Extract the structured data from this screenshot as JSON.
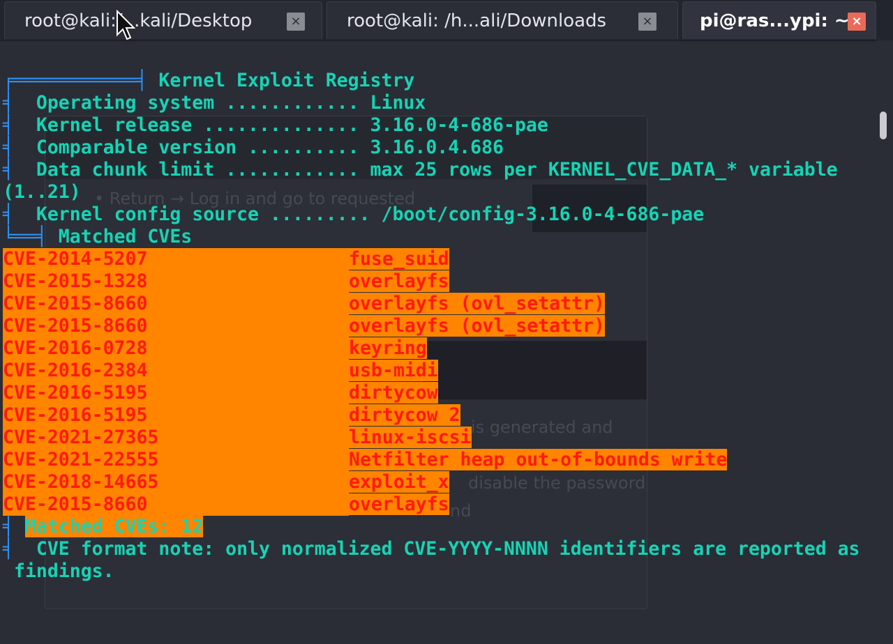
{
  "tabs": [
    {
      "title": "root@kali:/...kali/Desktop",
      "close_icon": "×"
    },
    {
      "title": "root@kali: /h...ali/Downloads",
      "close_icon": "×"
    },
    {
      "title": "pi@ras...ypi: ~",
      "close_icon": "×"
    }
  ],
  "terminal": {
    "header_title": "Kernel Exploit Registry",
    "info": [
      {
        "label": "Operating system ............",
        "value": "Linux"
      },
      {
        "label": "Kernel release ..............",
        "value": "3.16.0-4-686-pae"
      },
      {
        "label": "Comparable version ..........",
        "value": "3.16.0.4.686"
      },
      {
        "label": "Data chunk limit ............",
        "value": "max 25 rows per KERNEL_CVE_DATA_* variable"
      },
      {
        "label": "Kernel config source .........",
        "value": "/boot/config-3.16.0-4-686-pae"
      }
    ],
    "chunk_note": "(1..21)",
    "section_title": "Matched CVEs",
    "cves": [
      {
        "id": "CVE-2014-5207",
        "name": "fuse_suid"
      },
      {
        "id": "CVE-2015-1328",
        "name": "overlayfs"
      },
      {
        "id": "CVE-2015-8660",
        "name": "overlayfs (ovl_setattr)"
      },
      {
        "id": "CVE-2015-8660",
        "name": "overlayfs (ovl_setattr)"
      },
      {
        "id": "CVE-2016-0728",
        "name": "keyring"
      },
      {
        "id": "CVE-2016-2384",
        "name": "usb-midi"
      },
      {
        "id": "CVE-2016-5195",
        "name": "dirtycow"
      },
      {
        "id": "CVE-2016-5195",
        "name": "dirtycow 2"
      },
      {
        "id": "CVE-2021-27365",
        "name": "linux-iscsi"
      },
      {
        "id": "CVE-2021-22555",
        "name": "Netfilter heap out-of-bounds write"
      },
      {
        "id": "CVE-2018-14665",
        "name": "exploit_x"
      },
      {
        "id": "CVE-2015-8660",
        "name": "overlayfs"
      }
    ],
    "matched_count": "Matched CVEs: 12",
    "format_note_1": "CVE format note: only normalized CVE-YYYY-NNNN identifiers are reported as",
    "format_note_2": "findings."
  },
  "background_window": {
    "line1": "• Return → Log in and go to requested",
    "line2": "is generated and",
    "line3": "disable the password",
    "line4": "nd"
  },
  "colors": {
    "terminal_text": "#16d4b5",
    "box_drawing": "#2a8ff0",
    "highlight_bg": "#ff8500",
    "highlight_text": "#ff1a10",
    "active_close": "#ea6a5a"
  }
}
